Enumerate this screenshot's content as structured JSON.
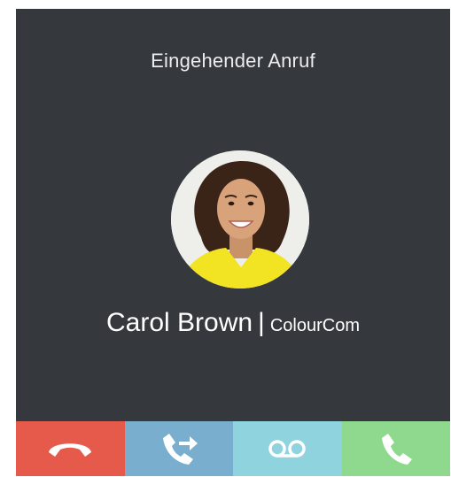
{
  "dialog": {
    "title": "Eingehender Anruf"
  },
  "caller": {
    "name": "Carol Brown",
    "separator": "|",
    "company": "ColourCom"
  },
  "actions": [
    {
      "name": "decline-call",
      "icon": "hang-up-icon",
      "color": "#e65a4c"
    },
    {
      "name": "transfer-call",
      "icon": "transfer-call-icon",
      "color": "#79aecf"
    },
    {
      "name": "send-to-voicemail",
      "icon": "voicemail-icon",
      "color": "#8fd3de"
    },
    {
      "name": "accept-call",
      "icon": "phone-icon",
      "color": "#8fd98e"
    }
  ],
  "colors": {
    "background": "#35393e",
    "title_text": "#ebecee",
    "avatar_shirt": "#f2e422"
  }
}
